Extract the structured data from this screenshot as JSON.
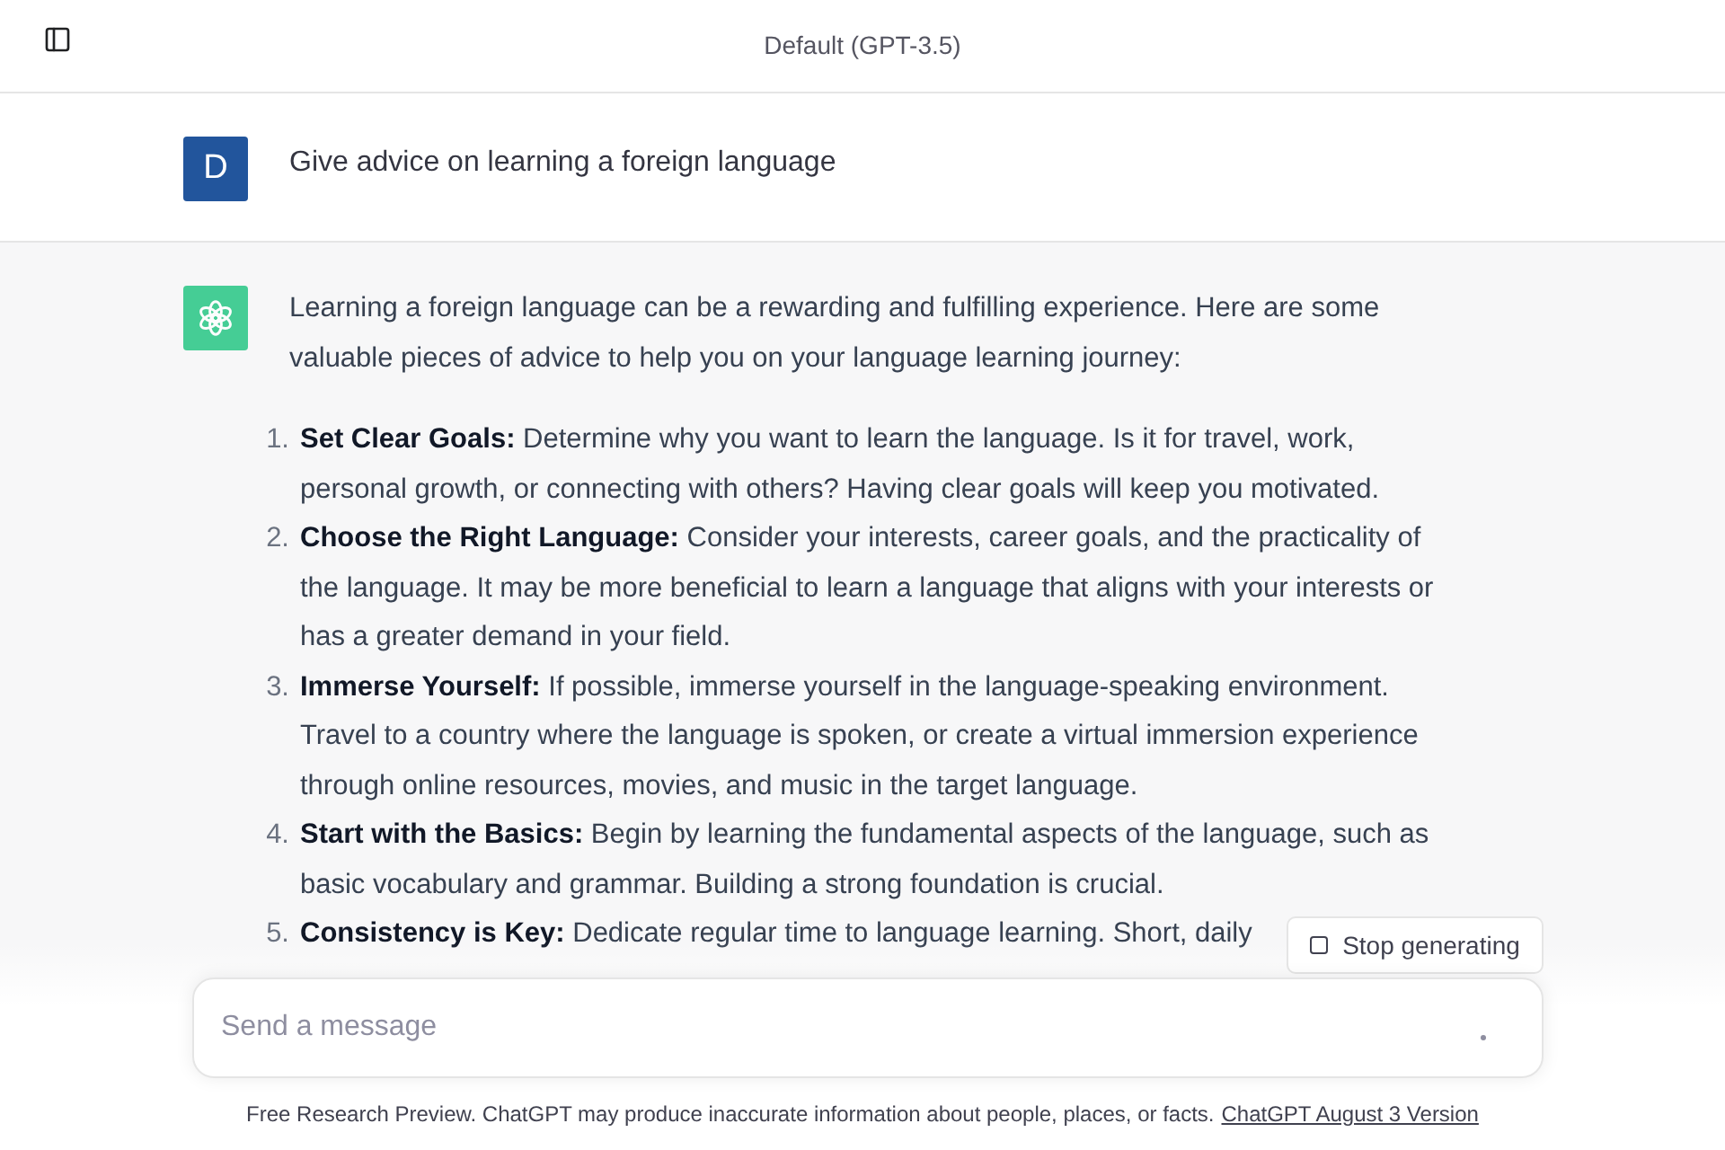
{
  "header": {
    "title": "Default (GPT-3.5)"
  },
  "messages": [
    {
      "kind": "user",
      "avatar_letter": "D",
      "text": "Give advice on learning a foreign language"
    },
    {
      "kind": "assistant",
      "text": "Learning a foreign language can be a rewarding and fulfilling experience. Here are some valuable pieces of advice to help you on your language learning journey:",
      "list": [
        {
          "number": "1.",
          "text": "**Set Clear Goals:** Determine why you want to learn the language. Is it for travel, work, personal growth, or connecting with others? Having clear goals will keep you motivated."
        },
        {
          "number": "2.",
          "text": "**Choose the Right Language:** Consider your interests, career goals, and the practicality of the language. It may be more beneficial to learn a language that aligns with your interests or has a greater demand in your field."
        },
        {
          "number": "3.",
          "text": "**Immerse Yourself:** If possible, immerse yourself in the language-speaking environment. Travel to a country where the language is spoken, or create a virtual immersion experience through online resources, movies, and music in the target language."
        },
        {
          "number": "4.",
          "text": "**Start with the Basics:** Begin by learning the fundamental aspects of the language, such as basic vocabulary and grammar. Building a strong foundation is crucial."
        },
        {
          "number": "5.",
          "text": "**Consistency is Key:** Dedicate regular time to language learning. Short, daily"
        }
      ]
    }
  ],
  "stop_button": {
    "label": "Stop generating"
  },
  "composer": {
    "placeholder": "Send a message"
  },
  "footer": {
    "text": "Free Research Preview. ChatGPT may produce inaccurate information about people, places, or facts.",
    "link": "ChatGPT August 3 Version"
  }
}
